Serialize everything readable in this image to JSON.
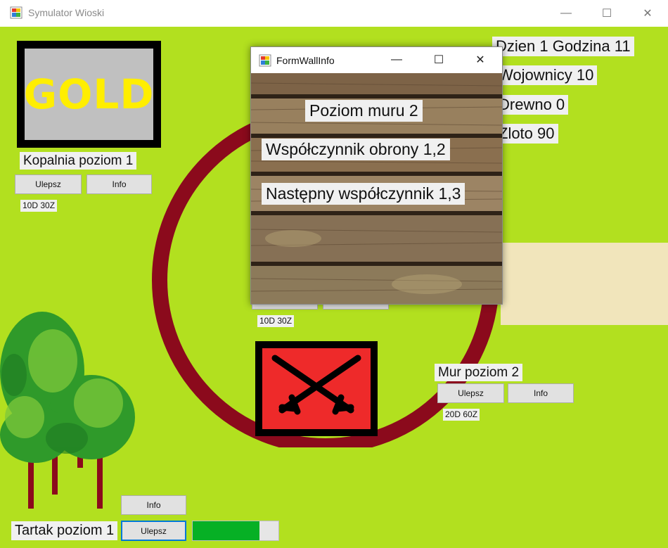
{
  "window": {
    "title": "Symulator Wioski",
    "minimize_icon": "—",
    "maximize_icon": "☐",
    "close_icon": "✕"
  },
  "mine": {
    "image_text": "GOLD",
    "level_label": "Kopalnia poziom 1",
    "upgrade_label": "Ulepsz",
    "info_label": "Info",
    "cost": "10D  30Z"
  },
  "stats": {
    "day_hour": "Dzien 1 Godzina 11",
    "warriors": "Wojownicy 10",
    "wood": "Drewno 0",
    "gold": "Zloto 90"
  },
  "barracks": {
    "cost": "10D  30Z",
    "icon": "crossed-swords-icon"
  },
  "wall": {
    "level_label": "Mur poziom 2",
    "upgrade_label": "Ulepsz",
    "info_label": "Info",
    "cost": "20D  60Z"
  },
  "sawmill": {
    "level_label": "Tartak poziom 1",
    "info_label": "Info",
    "upgrade_label": "Ulepsz",
    "progress": 0.78
  },
  "dialog": {
    "title": "FormWallInfo",
    "minimize_icon": "—",
    "maximize_icon": "☐",
    "close_icon": "✕",
    "wall_level": "Poziom muru 2",
    "defense_factor": "Współczynnik obrony 1,2",
    "next_factor": "Następny współczynnik 1,3"
  },
  "colors": {
    "grass": "#b2e01f",
    "wall_ring": "#8b0a1c",
    "road": "#f1e5bb",
    "sword_box": "#ee2a2a",
    "progress": "#06b025",
    "gold_text": "#ffee00"
  }
}
